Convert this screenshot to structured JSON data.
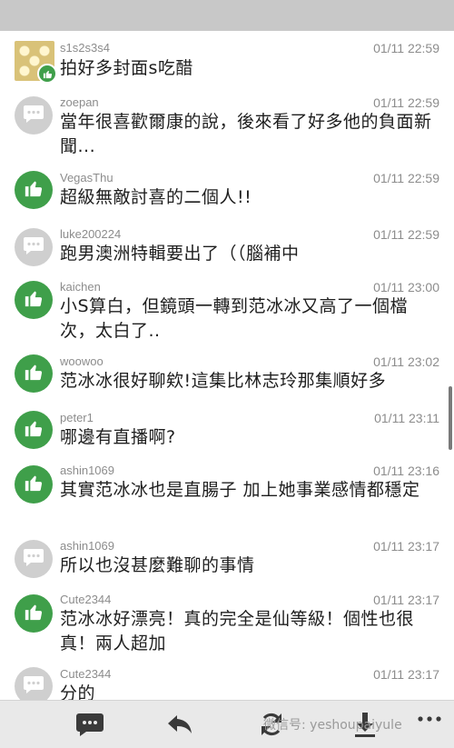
{
  "comments": [
    {
      "user": "s1s2s3s4",
      "time": "01/11 22:59",
      "text": "拍好多封面s吃醋",
      "avatar": "photo"
    },
    {
      "user": "zoepan",
      "time": "01/11 22:59",
      "text": "當年很喜歡爾康的說，後來看了好多他的負面新聞...",
      "avatar": "comment"
    },
    {
      "user": "VegasThu",
      "time": "01/11 22:59",
      "text": "超級無敵討喜的二個人!!",
      "avatar": "like"
    },
    {
      "user": "luke200224",
      "time": "01/11 22:59",
      "text": "跑男澳洲特輯要出了（（腦補中",
      "avatar": "comment"
    },
    {
      "user": "kaichen",
      "time": "01/11 23:00",
      "text": "小S算白，但鏡頭一轉到范冰冰又高了一個檔次，太白了..",
      "avatar": "like"
    },
    {
      "user": "woowoo",
      "time": "01/11 23:02",
      "text": "范冰冰很好聊欸!這集比林志玲那集順好多",
      "avatar": "like"
    },
    {
      "user": "peter1",
      "time": "01/11 23:11",
      "text": "哪邊有直播啊?",
      "avatar": "like"
    },
    {
      "user": "ashin1069",
      "time": "01/11 23:16",
      "text": "其實范冰冰也是直腸子 加上她事業感情都穩定",
      "avatar": "like"
    },
    {
      "user": "ashin1069",
      "time": "01/11 23:17",
      "text": "所以也沒甚麼難聊的事情",
      "avatar": "comment"
    },
    {
      "user": "Cute2344",
      "time": "01/11 23:17",
      "text": "范冰冰好漂亮！真的完全是仙等級！個性也很真！兩人超加",
      "avatar": "like"
    },
    {
      "user": "Cute2344",
      "time": "01/11 23:17",
      "text": "分的",
      "avatar": "comment"
    }
  ],
  "bottom_bar": {
    "icons": [
      "comment-icon",
      "reply-icon",
      "refresh-icon",
      "download-icon",
      "more-icon"
    ],
    "watermark": "微信号: yeshoupaiyule"
  },
  "colors": {
    "like": "#3f9f4a",
    "comment": "#cfcfcf",
    "top_bar": "#c8c8c8"
  }
}
